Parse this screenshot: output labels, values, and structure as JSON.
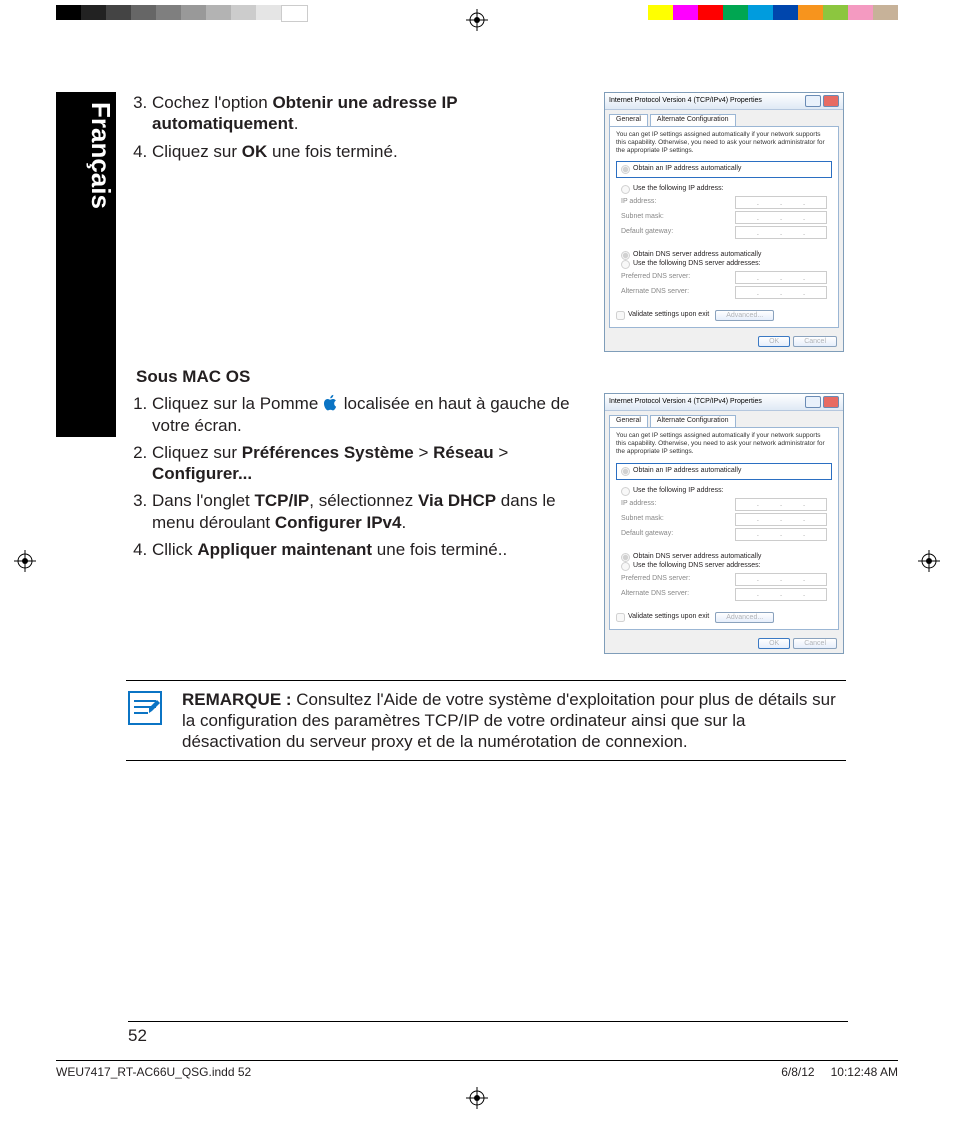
{
  "language_tab": "Français",
  "steps_a": [
    {
      "pre": "Cochez l'option ",
      "bold": "Obtenir une adresse IP automatiquement",
      "post": "."
    },
    {
      "pre": "Cliquez sur ",
      "bold": "OK",
      "post": " une fois terminé."
    }
  ],
  "subheading": "Sous MAC OS",
  "steps_b": [
    {
      "text1": "Cliquez sur la Pomme ",
      "text2": " localisée en haut à gauche de votre écran."
    },
    {
      "text1": "Cliquez sur ",
      "bold1": "Préférences Système",
      "sep1": " > ",
      "bold2": "Réseau",
      "sep2": " > ",
      "bold3": "Configurer..."
    },
    {
      "text1": "Dans l'onglet ",
      "bold1": "TCP/IP",
      "text2": ", sélectionnez ",
      "bold2": "Via DHCP",
      "text3": " dans le menu déroulant ",
      "bold3": "Configurer IPv4",
      "post": "."
    },
    {
      "text1": "Cllick ",
      "bold1": "Appliquer maintenant",
      "post": " une fois terminé.."
    }
  ],
  "remark": {
    "bold": "REMARQUE : ",
    "text": "Consultez l'Aide de votre système d'exploitation pour plus de détails sur la configuration des paramètres TCP/IP de votre ordinateur ainsi que sur la désactivation du serveur proxy et de la numérotation de connexion."
  },
  "page_number": "52",
  "footer_file": "WEU7417_RT-AC66U_QSG.indd   52",
  "footer_date": "6/8/12",
  "footer_time": "10:12:48 AM",
  "dialog": {
    "title": "Internet Protocol Version 4 (TCP/IPv4) Properties",
    "tab1": "General",
    "tab2": "Alternate Configuration",
    "desc": "You can get IP settings assigned automatically if your network supports this capability. Otherwise, you need to ask your network administrator for the appropriate IP settings.",
    "opt_auto_ip": "Obtain an IP address automatically",
    "opt_use_ip": "Use the following IP address:",
    "lab_ip": "IP address:",
    "lab_mask": "Subnet mask:",
    "lab_gw": "Default gateway:",
    "opt_auto_dns": "Obtain DNS server address automatically",
    "opt_use_dns": "Use the following DNS server addresses:",
    "lab_pdns": "Preferred DNS server:",
    "lab_adns": "Alternate DNS server:",
    "validate": "Validate settings upon exit",
    "advanced": "Advanced...",
    "ok": "OK",
    "cancel": "Cancel"
  },
  "colors_left": [
    "#000000",
    "#222222",
    "#444444",
    "#666666",
    "#7f7f7f",
    "#999999",
    "#b3b3b3",
    "#cccccc",
    "#e5e5e5",
    "#ffffff"
  ],
  "colors_right": [
    "#ffff00",
    "#ff00ff",
    "#ff0000",
    "#00a651",
    "#009cde",
    "#0046ad",
    "#f7941d",
    "#8cc63f",
    "#f49ac1",
    "#c7b299"
  ]
}
